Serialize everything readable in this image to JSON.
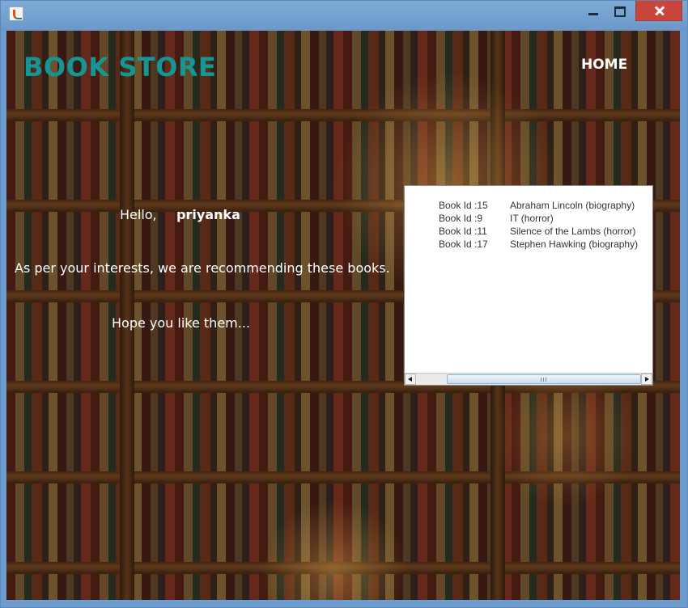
{
  "window": {
    "icon": "java-cup-icon",
    "controls": [
      "minimize-icon",
      "maximize-icon",
      "close-icon"
    ]
  },
  "header": {
    "brand": "BOOK STORE",
    "home_label": "HOME",
    "brand_color": "#169595"
  },
  "greeting": {
    "label": "Hello,",
    "username": "priyanka"
  },
  "messages": {
    "recommendation": "As per your interests, we are recommending these books.",
    "closing": "Hope you like them..."
  },
  "books": [
    {
      "id_label": "Book Id :15",
      "title": "Abraham Lincoln  (biography)"
    },
    {
      "id_label": "Book Id :9",
      "title": "IT  (horror)"
    },
    {
      "id_label": "Book Id :11",
      "title": "Silence of the Lambs  (horror)"
    },
    {
      "id_label": "Book Id :17",
      "title": "Stephen Hawking  (biography)"
    }
  ]
}
